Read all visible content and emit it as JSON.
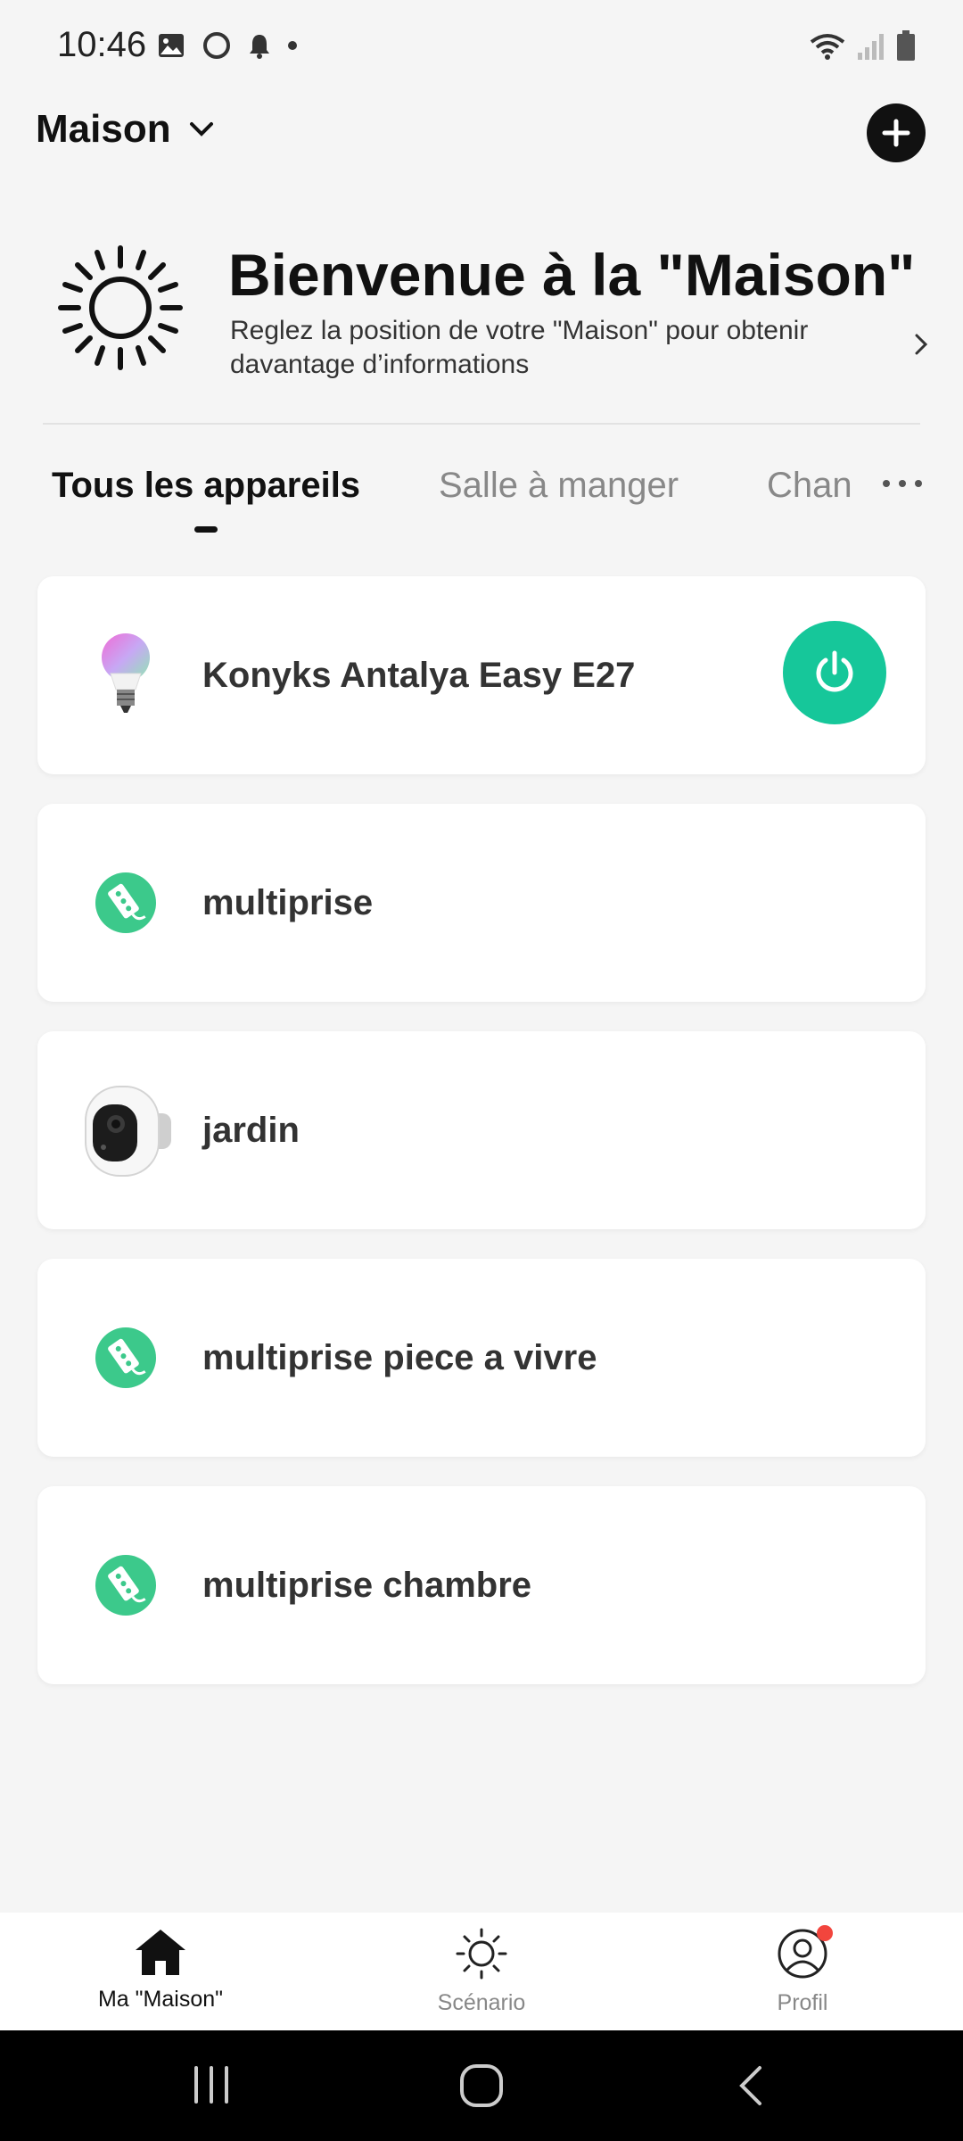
{
  "status_bar": {
    "time": "10:46",
    "icons_left": [
      "gallery-icon",
      "circle-app-icon",
      "bell-icon",
      "dot-icon"
    ],
    "icons_right": [
      "wifi-icon",
      "signal-icon",
      "battery-icon"
    ]
  },
  "header": {
    "home_name": "Maison",
    "dropdown_icon": "chevron-down-icon",
    "add_icon": "plus-icon"
  },
  "welcome": {
    "icon": "sun-icon",
    "title": "Bienvenue à la \"Maison\"",
    "subtitle": "Reglez la position de votre \"Maison\" pour obtenir davantage d’informations"
  },
  "tabs": {
    "items": [
      {
        "label": "Tous les appareils",
        "active": true
      },
      {
        "label": "Salle à manger",
        "active": false
      },
      {
        "label": "Chan",
        "active": false
      }
    ],
    "more_icon": "more-dots-icon"
  },
  "devices": [
    {
      "name": "Konyks Antalya Easy E27",
      "icon": "bulb-icon",
      "has_power": true,
      "power_color": "#16c79a"
    },
    {
      "name": "multiprise",
      "icon": "power-strip-icon",
      "has_power": false
    },
    {
      "name": "jardin",
      "icon": "camera-icon",
      "has_power": false
    },
    {
      "name": "multiprise piece a vivre",
      "icon": "power-strip-icon",
      "has_power": false
    },
    {
      "name": "multiprise chambre",
      "icon": "power-strip-icon",
      "has_power": false
    }
  ],
  "bottom_nav": {
    "items": [
      {
        "label": "Ma \"Maison\"",
        "icon": "house-icon",
        "active": true
      },
      {
        "label": "Scénario",
        "icon": "sun-icon",
        "active": false
      },
      {
        "label": "Profil",
        "icon": "user-circle-icon",
        "active": false,
        "badge": true
      }
    ]
  },
  "system_nav": {
    "buttons": [
      "recents-icon",
      "home-circle-icon",
      "back-icon"
    ]
  },
  "colors": {
    "accent": "#16c79a",
    "badge": "#f2453d",
    "background": "#f5f5f5"
  }
}
